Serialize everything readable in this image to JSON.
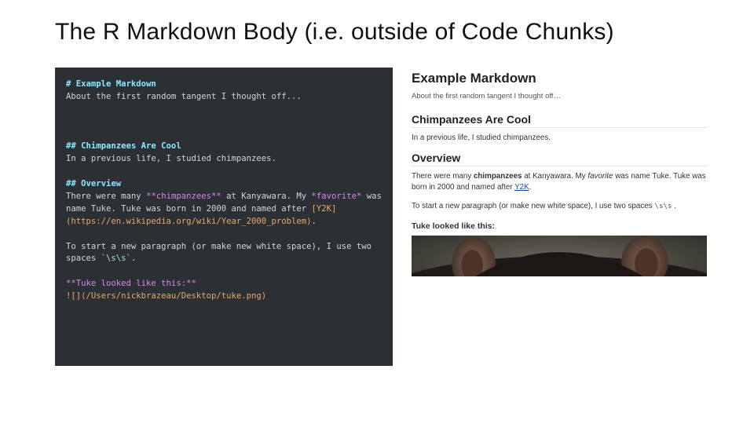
{
  "title": "The R Markdown Body (i.e. outside of Code Chunks)",
  "source": {
    "h1": "# Example Markdown",
    "p1": "About the first random tangent I thought off...",
    "h2a": "## Chimpanzees Are Cool",
    "p2": "In a previous life, I studied chimpanzees.",
    "h2b": "## Overview",
    "p3a": "There were many ",
    "p3bold": "**chimpanzees**",
    "p3b": " at Kanyawara. My ",
    "p3ital": "*favorite*",
    "p3c": " was name Tuke. Tuke was born in 2000 and named after ",
    "p3linklbl": "[Y2K]",
    "p3linkurl": "(https://en.wikipedia.org/wiki/Year_2000_problem)",
    "p3d": ".",
    "p4a": "To start a new paragraph (or make new white space), I use two spaces ",
    "p4code": "`\\s\\s`",
    "p4b": ".",
    "p5bold": "**Tuke looked like this:**",
    "p5img": "![](/Users/nickbrazeau/Desktop/tuke.png)"
  },
  "rendered": {
    "h1": "Example Markdown",
    "sub": "About the first random tangent I thought off…",
    "h2a": "Chimpanzees Are Cool",
    "p2": "In a previous life, I studied chimpanzees.",
    "h2b": "Overview",
    "p3a": "There were many ",
    "p3bold": "chimpanzees",
    "p3b": " at Kanyawara. My ",
    "p3ital": "favorite",
    "p3c": " was name Tuke. Tuke was born in 2000 and named after ",
    "p3link": "Y2K",
    "p3d": ".",
    "p4a": "To start a new paragraph (or make new white space), I use two spaces ",
    "p4code": "\\s\\s",
    "p4b": " .",
    "p5": "Tuke looked like this:"
  },
  "chart_data": null
}
